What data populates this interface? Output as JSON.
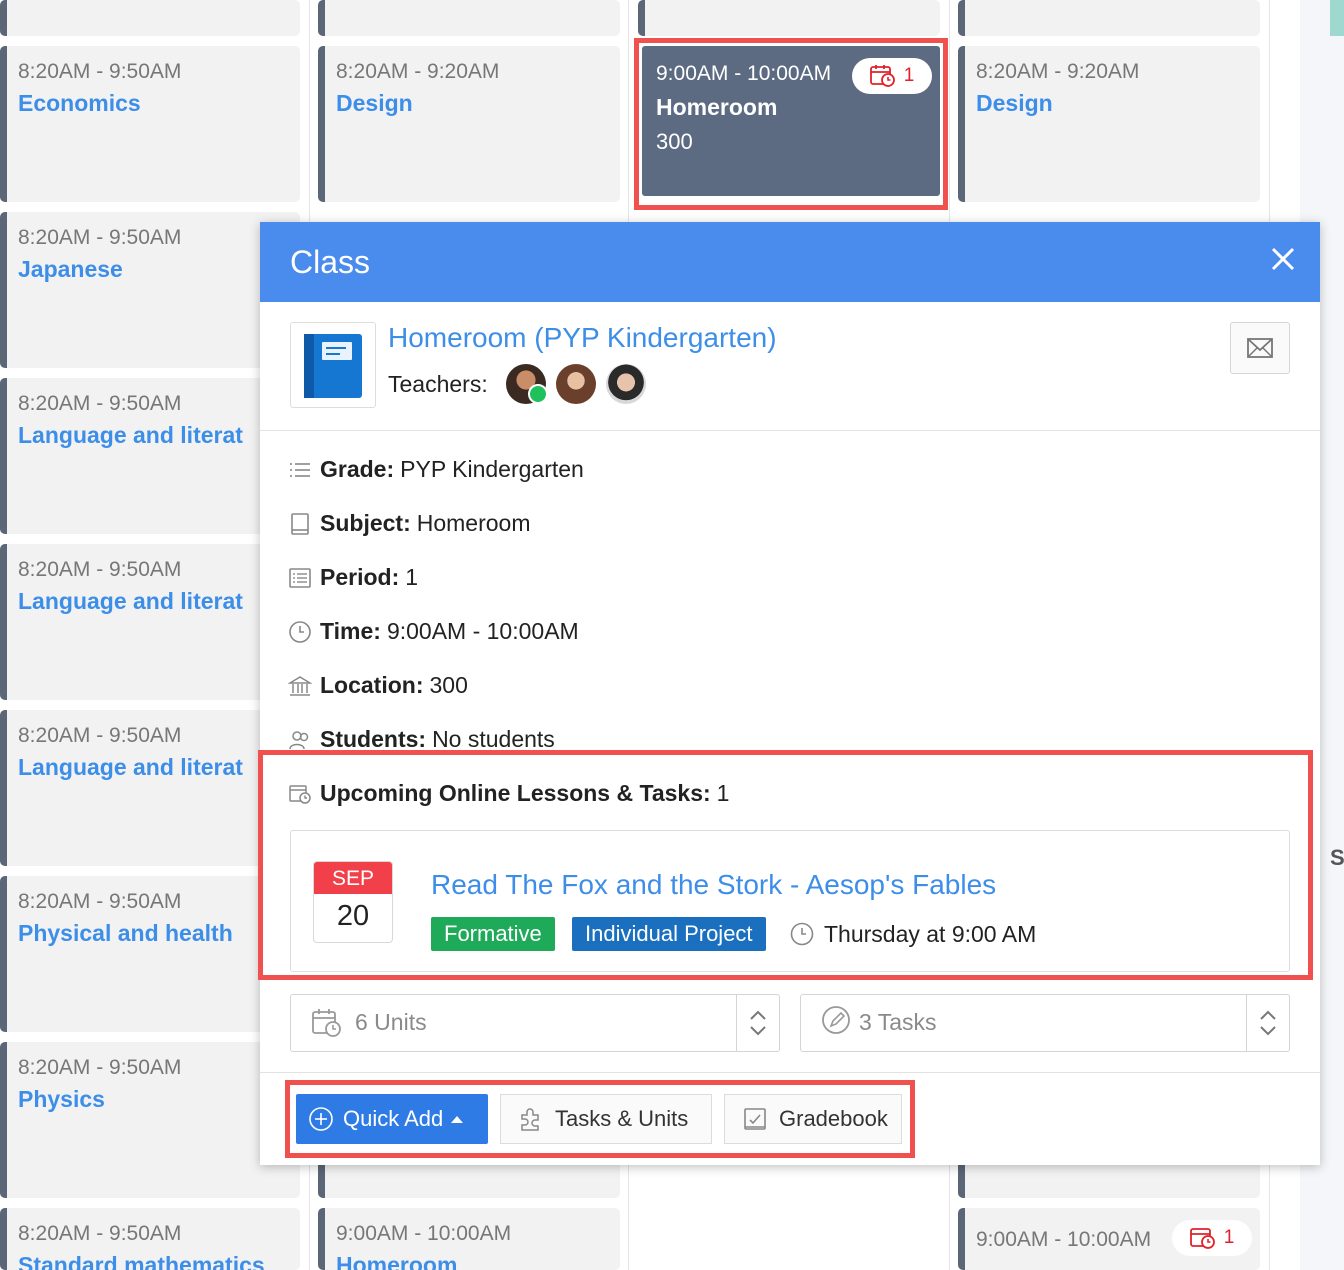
{
  "calendar": {
    "col1": [
      {
        "time": "8:20AM - 9:50AM",
        "name": "Economics"
      },
      {
        "time": "8:20AM - 9:50AM",
        "name": "Japanese"
      },
      {
        "time": "8:20AM - 9:50AM",
        "name": "Language and literat"
      },
      {
        "time": "8:20AM - 9:50AM",
        "name": "Language and literat"
      },
      {
        "time": "8:20AM - 9:50AM",
        "name": "Language and literat"
      },
      {
        "time": "8:20AM - 9:50AM",
        "name": "Physical and health"
      },
      {
        "time": "8:20AM - 9:50AM",
        "name": "Physics"
      },
      {
        "time": "8:20AM - 9:50AM",
        "name": "Standard mathematics"
      }
    ],
    "col2_top": {
      "time": "8:20AM - 9:20AM",
      "name": "Design"
    },
    "col2_bottom": {
      "time": "9:00AM - 10:00AM",
      "name": "Homeroom"
    },
    "selected": {
      "time": "9:00AM - 10:00AM",
      "name": "Homeroom",
      "location": "300",
      "badge": "1"
    },
    "col4_top": {
      "time": "8:20AM - 9:20AM",
      "name": "Design"
    },
    "col4_bottom": {
      "time": "9:00AM - 10:00AM",
      "badge": "1"
    },
    "right_edge_letter": "S"
  },
  "modal": {
    "title": "Class",
    "class_name": "Homeroom (PYP Kindergarten)",
    "teachers_label": "Teachers:",
    "details": [
      {
        "label": "Grade:",
        "value": "PYP Kindergarten",
        "icon": "list-icon"
      },
      {
        "label": "Subject:",
        "value": "Homeroom",
        "icon": "book-icon"
      },
      {
        "label": "Period:",
        "value": "1",
        "icon": "period-icon"
      },
      {
        "label": "Time:",
        "value": "9:00AM - 10:00AM",
        "icon": "clock-icon"
      },
      {
        "label": "Location:",
        "value": "300",
        "icon": "building-icon"
      },
      {
        "label": "Students:",
        "value": "No students",
        "icon": "students-icon"
      }
    ],
    "upcoming": {
      "label": "Upcoming Online Lessons & Tasks:",
      "count": "1",
      "lesson": {
        "month": "SEP",
        "day": "20",
        "title": "Read The Fox and the Stork - Aesop's Fables",
        "tags": [
          "Formative",
          "Individual Project"
        ],
        "when": "Thursday at 9:00 AM"
      }
    },
    "units_select": "6 Units",
    "tasks_select": "3 Tasks",
    "buttons": {
      "quick_add": "Quick Add",
      "tasks_units": "Tasks & Units",
      "gradebook": "Gradebook"
    }
  },
  "colors": {
    "accent": "#4a8bee",
    "link": "#3d8ee8",
    "highlight": "#f0514f",
    "formative": "#1eaa59",
    "project": "#1a6fbf",
    "dark_card": "#5c6a82"
  }
}
